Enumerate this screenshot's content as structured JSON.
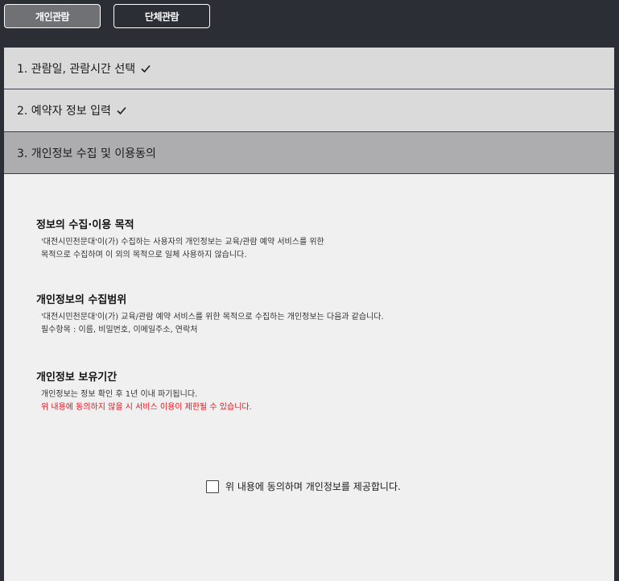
{
  "tabs": {
    "individual": "개인관람",
    "group": "단체관람"
  },
  "steps": [
    {
      "label": "1. 관람일, 관람시간 선택",
      "completed": true
    },
    {
      "label": "2. 예약자 정보 입력",
      "completed": true
    },
    {
      "label": "3. 개인정보 수집 및 이용동의",
      "completed": false
    }
  ],
  "sections": {
    "purpose": {
      "title": "정보의 수집·이용 목적",
      "lines": [
        "'대전시민천문대'이(가) 수집하는 사용자의 개인정보는 교육/관람 예약 서비스를 위한",
        "목적으로 수집하며 이 외의 목적으로 일체 사용하지 않습니다."
      ]
    },
    "scope": {
      "title": "개인정보의 수집범위",
      "lines": [
        "'대전시민천문대'이(가) 교육/관람 예약 서비스를 위한 목적으로 수집하는 개인정보는 다음과 같습니다.",
        "필수항목 : 이름, 비밀번호, 이메일주소, 연락처"
      ]
    },
    "retention": {
      "title": "개인정보 보유기간",
      "lines": [
        "개인정보는 정보 확인 후 1년 이내 파기됩니다."
      ],
      "warning": "위 내용에 동의하지 않을 시 서비스 이용이 제한될 수 있습니다."
    }
  },
  "consent": {
    "label": "위 내용에 동의하며 개인정보를 제공합니다.",
    "checked": false
  },
  "colors": {
    "background": "#2c2e35",
    "panel": "#f0f0f0",
    "active_step": "#adadb0",
    "warning": "#e2141e"
  }
}
